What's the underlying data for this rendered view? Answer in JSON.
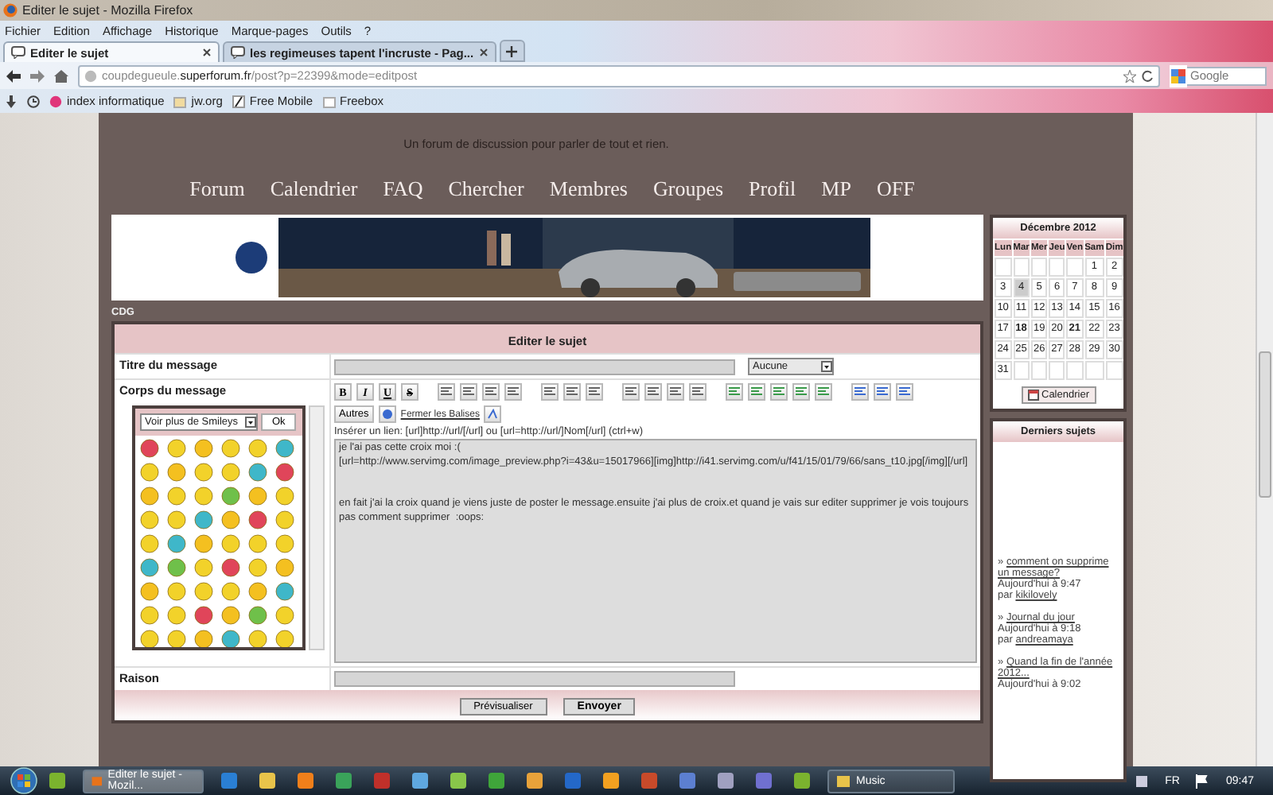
{
  "window": {
    "title": "Editer le sujet - Mozilla Firefox"
  },
  "menu": [
    "Fichier",
    "Edition",
    "Affichage",
    "Historique",
    "Marque-pages",
    "Outils",
    "?"
  ],
  "tabs": [
    {
      "label": "Editer le sujet",
      "selected": true
    },
    {
      "label": "les regimeuses tapent l'incruste - Pag...",
      "selected": false
    }
  ],
  "address": {
    "prefix": "coupdegueule.",
    "domain": "superforum.fr",
    "path": "/post?p=22399&mode=editpost"
  },
  "search": {
    "placeholder": "Google"
  },
  "bookmarks": [
    "index informatique",
    "jw.org",
    "Free Mobile",
    "Freebox"
  ],
  "forum": {
    "tagline": "Un forum de discussion pour parler de tout et rien.",
    "nav": [
      "Forum",
      "Calendrier",
      "FAQ",
      "Chercher",
      "Membres",
      "Groupes",
      "Profil",
      "MP",
      "OFF"
    ],
    "breadcrumb": "CDG",
    "form": {
      "title": "Editer le sujet",
      "subject_label": "Titre du message",
      "tag_select": "Aucune",
      "body_label": "Corps du message",
      "smiley_select": "Voir plus de Smileys",
      "smiley_ok": "Ok",
      "format_buttons": [
        "B",
        "I",
        "U",
        "S"
      ],
      "others": "Autres",
      "close_tags": "Fermer les Balises",
      "hint": "Insérer un lien: [url]http://url/[/url] ou [url=http://url/]Nom[/url] (ctrl+w)",
      "message": "je l'ai pas cette croix moi :(\n[url=http://www.servimg.com/image_preview.php?i=43&u=15017966][img]http://i41.servimg.com/u/f41/15/01/79/66/sans_t10.jpg[/img][/url]\n\n\nen fait j'ai la croix quand je viens juste de poster le message.ensuite j'ai plus de croix.et quand je vais sur editer supprimer je vois toujours pas comment supprimer  :oops: ",
      "reason_label": "Raison",
      "buttons": [
        "Prévisualiser",
        "Envoyer"
      ]
    },
    "calendar": {
      "title": "Décembre 2012",
      "weekdays": [
        "Lun",
        "Mar",
        "Mer",
        "Jeu",
        "Ven",
        "Sam",
        "Dim"
      ],
      "weeks": [
        {
          "kind": "first",
          "days": [
            {
              "day": "1",
              "today": false,
              "event": false
            },
            {
              "day": "2",
              "today": false,
              "event": false
            }
          ]
        },
        {
          "kind": "full",
          "days": [
            {
              "day": "3",
              "today": false,
              "event": false
            },
            {
              "day": "4",
              "today": true,
              "event": false
            },
            {
              "day": "5",
              "today": false,
              "event": false
            },
            {
              "day": "6",
              "today": false,
              "event": false
            },
            {
              "day": "7",
              "today": false,
              "event": false
            },
            {
              "day": "8",
              "today": false,
              "event": false
            },
            {
              "day": "9",
              "today": false,
              "event": false
            }
          ]
        },
        {
          "kind": "full",
          "days": [
            {
              "day": "10",
              "today": false,
              "event": false
            },
            {
              "day": "11",
              "today": false,
              "event": false
            },
            {
              "day": "12",
              "today": false,
              "event": false
            },
            {
              "day": "13",
              "today": false,
              "event": false
            },
            {
              "day": "14",
              "today": false,
              "event": false
            },
            {
              "day": "15",
              "today": false,
              "event": false
            },
            {
              "day": "16",
              "today": false,
              "event": false
            }
          ]
        },
        {
          "kind": "full",
          "days": [
            {
              "day": "17",
              "today": false,
              "event": false
            },
            {
              "day": "18",
              "today": false,
              "event": true
            },
            {
              "day": "19",
              "today": false,
              "event": false
            },
            {
              "day": "20",
              "today": false,
              "event": false
            },
            {
              "day": "21",
              "today": false,
              "event": true
            },
            {
              "day": "22",
              "today": false,
              "event": false
            },
            {
              "day": "23",
              "today": false,
              "event": false
            }
          ]
        },
        {
          "kind": "full",
          "days": [
            {
              "day": "24",
              "today": false,
              "event": false
            },
            {
              "day": "25",
              "today": false,
              "event": false
            },
            {
              "day": "26",
              "today": false,
              "event": false
            },
            {
              "day": "27",
              "today": false,
              "event": false
            },
            {
              "day": "28",
              "today": false,
              "event": false
            },
            {
              "day": "29",
              "today": false,
              "event": false
            },
            {
              "day": "30",
              "today": false,
              "event": false
            }
          ]
        },
        {
          "kind": "last",
          "days": [
            {
              "day": "31",
              "today": false,
              "event": false
            }
          ]
        }
      ],
      "button": "Calendrier"
    },
    "latest": {
      "title": "Derniers sujets",
      "items": [
        {
          "bullet": "»",
          "title": "comment on supprime un message?",
          "time": "Aujourd'hui à 9:47",
          "by": "par",
          "author": "kikilovely"
        },
        {
          "bullet": "»",
          "title": "Journal du jour",
          "time": "Aujourd'hui à 9:18",
          "by": "par",
          "author": "andreamaya"
        },
        {
          "bullet": "»",
          "title": "Quand la fin de l'année 2012...",
          "time": "Aujourd'hui à 9:02"
        }
      ]
    }
  },
  "taskbar": {
    "items": [
      {
        "kind": "pinned"
      },
      {
        "kind": "task",
        "label": "Editer le sujet - Mozil...",
        "selected": true
      },
      {
        "kind": "pinned"
      },
      {
        "kind": "pinned"
      },
      {
        "kind": "pinned"
      },
      {
        "kind": "pinned"
      },
      {
        "kind": "pinned"
      },
      {
        "kind": "pinned"
      },
      {
        "kind": "pinned"
      },
      {
        "kind": "pinned"
      },
      {
        "kind": "pinned"
      },
      {
        "kind": "pinned"
      },
      {
        "kind": "pinned"
      },
      {
        "kind": "pinned"
      },
      {
        "kind": "pinned"
      },
      {
        "kind": "pinned"
      },
      {
        "kind": "pinned"
      },
      {
        "kind": "pinned"
      },
      {
        "kind": "task",
        "label": "Music",
        "selected": false
      }
    ],
    "language": "FR",
    "clock": "09:47"
  }
}
